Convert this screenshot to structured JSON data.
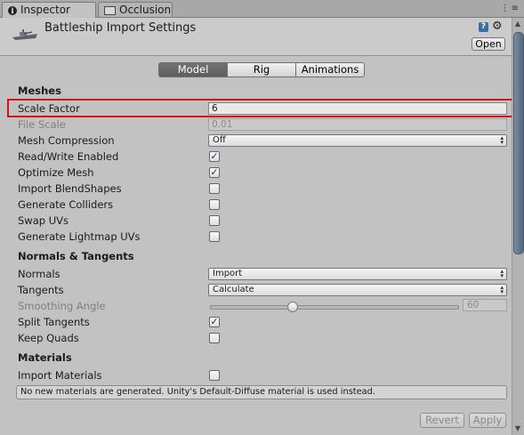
{
  "tabs": [
    {
      "label": "Inspector",
      "icon": "info-icon"
    },
    {
      "label": "Occlusion",
      "icon": "occlusion-icon"
    }
  ],
  "header": {
    "title": "Battleship Import Settings",
    "open_label": "Open",
    "asset_icon": "battleship-icon"
  },
  "mode_tabs": [
    "Model",
    "Rig",
    "Animations"
  ],
  "meshes": {
    "heading": "Meshes",
    "scale_factor": {
      "label": "Scale Factor",
      "value": "6"
    },
    "file_scale": {
      "label": "File Scale",
      "value": "0.01"
    },
    "mesh_compression": {
      "label": "Mesh Compression",
      "value": "Off"
    },
    "read_write": {
      "label": "Read/Write Enabled",
      "checked": true
    },
    "optimize_mesh": {
      "label": "Optimize Mesh",
      "checked": true
    },
    "import_blendshapes": {
      "label": "Import BlendShapes",
      "checked": false
    },
    "generate_colliders": {
      "label": "Generate Colliders",
      "checked": false
    },
    "swap_uvs": {
      "label": "Swap UVs",
      "checked": false
    },
    "generate_lightmap_uvs": {
      "label": "Generate Lightmap UVs",
      "checked": false
    }
  },
  "normals": {
    "heading": "Normals & Tangents",
    "normals": {
      "label": "Normals",
      "value": "Import"
    },
    "tangents": {
      "label": "Tangents",
      "value": "Calculate"
    },
    "smoothing_angle": {
      "label": "Smoothing Angle",
      "value": "60"
    },
    "split_tangents": {
      "label": "Split Tangents",
      "checked": true
    },
    "keep_quads": {
      "label": "Keep Quads",
      "checked": false
    }
  },
  "materials": {
    "heading": "Materials",
    "import_materials": {
      "label": "Import Materials",
      "checked": false
    },
    "info": "No new materials are generated. Unity's Default-Diffuse material is used instead."
  },
  "footer": {
    "revert": "Revert",
    "apply": "Apply"
  },
  "colors": {
    "highlight": "#d4141b",
    "active_tab": "#6a6a6a",
    "panel_bg": "#c2c2c2"
  }
}
